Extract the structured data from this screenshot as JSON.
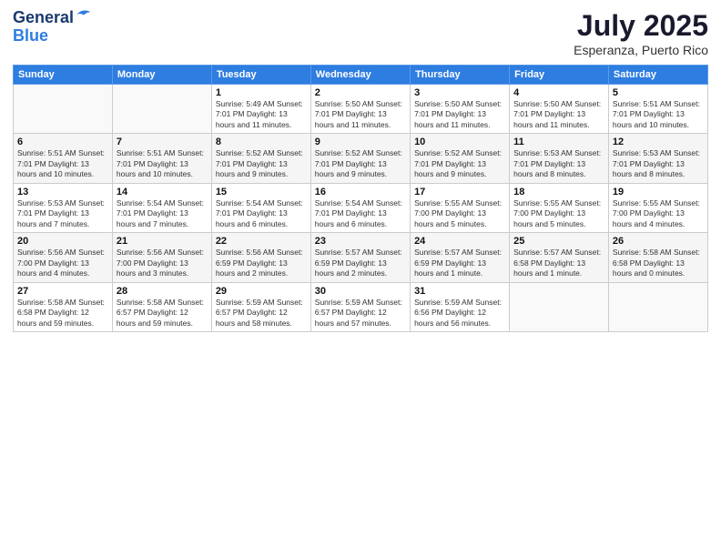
{
  "header": {
    "logo_line1": "General",
    "logo_line2": "Blue",
    "month": "July 2025",
    "location": "Esperanza, Puerto Rico"
  },
  "days_of_week": [
    "Sunday",
    "Monday",
    "Tuesday",
    "Wednesday",
    "Thursday",
    "Friday",
    "Saturday"
  ],
  "weeks": [
    [
      {
        "day": "",
        "info": ""
      },
      {
        "day": "",
        "info": ""
      },
      {
        "day": "1",
        "info": "Sunrise: 5:49 AM\nSunset: 7:01 PM\nDaylight: 13 hours and 11 minutes."
      },
      {
        "day": "2",
        "info": "Sunrise: 5:50 AM\nSunset: 7:01 PM\nDaylight: 13 hours and 11 minutes."
      },
      {
        "day": "3",
        "info": "Sunrise: 5:50 AM\nSunset: 7:01 PM\nDaylight: 13 hours and 11 minutes."
      },
      {
        "day": "4",
        "info": "Sunrise: 5:50 AM\nSunset: 7:01 PM\nDaylight: 13 hours and 11 minutes."
      },
      {
        "day": "5",
        "info": "Sunrise: 5:51 AM\nSunset: 7:01 PM\nDaylight: 13 hours and 10 minutes."
      }
    ],
    [
      {
        "day": "6",
        "info": "Sunrise: 5:51 AM\nSunset: 7:01 PM\nDaylight: 13 hours and 10 minutes."
      },
      {
        "day": "7",
        "info": "Sunrise: 5:51 AM\nSunset: 7:01 PM\nDaylight: 13 hours and 10 minutes."
      },
      {
        "day": "8",
        "info": "Sunrise: 5:52 AM\nSunset: 7:01 PM\nDaylight: 13 hours and 9 minutes."
      },
      {
        "day": "9",
        "info": "Sunrise: 5:52 AM\nSunset: 7:01 PM\nDaylight: 13 hours and 9 minutes."
      },
      {
        "day": "10",
        "info": "Sunrise: 5:52 AM\nSunset: 7:01 PM\nDaylight: 13 hours and 9 minutes."
      },
      {
        "day": "11",
        "info": "Sunrise: 5:53 AM\nSunset: 7:01 PM\nDaylight: 13 hours and 8 minutes."
      },
      {
        "day": "12",
        "info": "Sunrise: 5:53 AM\nSunset: 7:01 PM\nDaylight: 13 hours and 8 minutes."
      }
    ],
    [
      {
        "day": "13",
        "info": "Sunrise: 5:53 AM\nSunset: 7:01 PM\nDaylight: 13 hours and 7 minutes."
      },
      {
        "day": "14",
        "info": "Sunrise: 5:54 AM\nSunset: 7:01 PM\nDaylight: 13 hours and 7 minutes."
      },
      {
        "day": "15",
        "info": "Sunrise: 5:54 AM\nSunset: 7:01 PM\nDaylight: 13 hours and 6 minutes."
      },
      {
        "day": "16",
        "info": "Sunrise: 5:54 AM\nSunset: 7:01 PM\nDaylight: 13 hours and 6 minutes."
      },
      {
        "day": "17",
        "info": "Sunrise: 5:55 AM\nSunset: 7:00 PM\nDaylight: 13 hours and 5 minutes."
      },
      {
        "day": "18",
        "info": "Sunrise: 5:55 AM\nSunset: 7:00 PM\nDaylight: 13 hours and 5 minutes."
      },
      {
        "day": "19",
        "info": "Sunrise: 5:55 AM\nSunset: 7:00 PM\nDaylight: 13 hours and 4 minutes."
      }
    ],
    [
      {
        "day": "20",
        "info": "Sunrise: 5:56 AM\nSunset: 7:00 PM\nDaylight: 13 hours and 4 minutes."
      },
      {
        "day": "21",
        "info": "Sunrise: 5:56 AM\nSunset: 7:00 PM\nDaylight: 13 hours and 3 minutes."
      },
      {
        "day": "22",
        "info": "Sunrise: 5:56 AM\nSunset: 6:59 PM\nDaylight: 13 hours and 2 minutes."
      },
      {
        "day": "23",
        "info": "Sunrise: 5:57 AM\nSunset: 6:59 PM\nDaylight: 13 hours and 2 minutes."
      },
      {
        "day": "24",
        "info": "Sunrise: 5:57 AM\nSunset: 6:59 PM\nDaylight: 13 hours and 1 minute."
      },
      {
        "day": "25",
        "info": "Sunrise: 5:57 AM\nSunset: 6:58 PM\nDaylight: 13 hours and 1 minute."
      },
      {
        "day": "26",
        "info": "Sunrise: 5:58 AM\nSunset: 6:58 PM\nDaylight: 13 hours and 0 minutes."
      }
    ],
    [
      {
        "day": "27",
        "info": "Sunrise: 5:58 AM\nSunset: 6:58 PM\nDaylight: 12 hours and 59 minutes."
      },
      {
        "day": "28",
        "info": "Sunrise: 5:58 AM\nSunset: 6:57 PM\nDaylight: 12 hours and 59 minutes."
      },
      {
        "day": "29",
        "info": "Sunrise: 5:59 AM\nSunset: 6:57 PM\nDaylight: 12 hours and 58 minutes."
      },
      {
        "day": "30",
        "info": "Sunrise: 5:59 AM\nSunset: 6:57 PM\nDaylight: 12 hours and 57 minutes."
      },
      {
        "day": "31",
        "info": "Sunrise: 5:59 AM\nSunset: 6:56 PM\nDaylight: 12 hours and 56 minutes."
      },
      {
        "day": "",
        "info": ""
      },
      {
        "day": "",
        "info": ""
      }
    ]
  ]
}
